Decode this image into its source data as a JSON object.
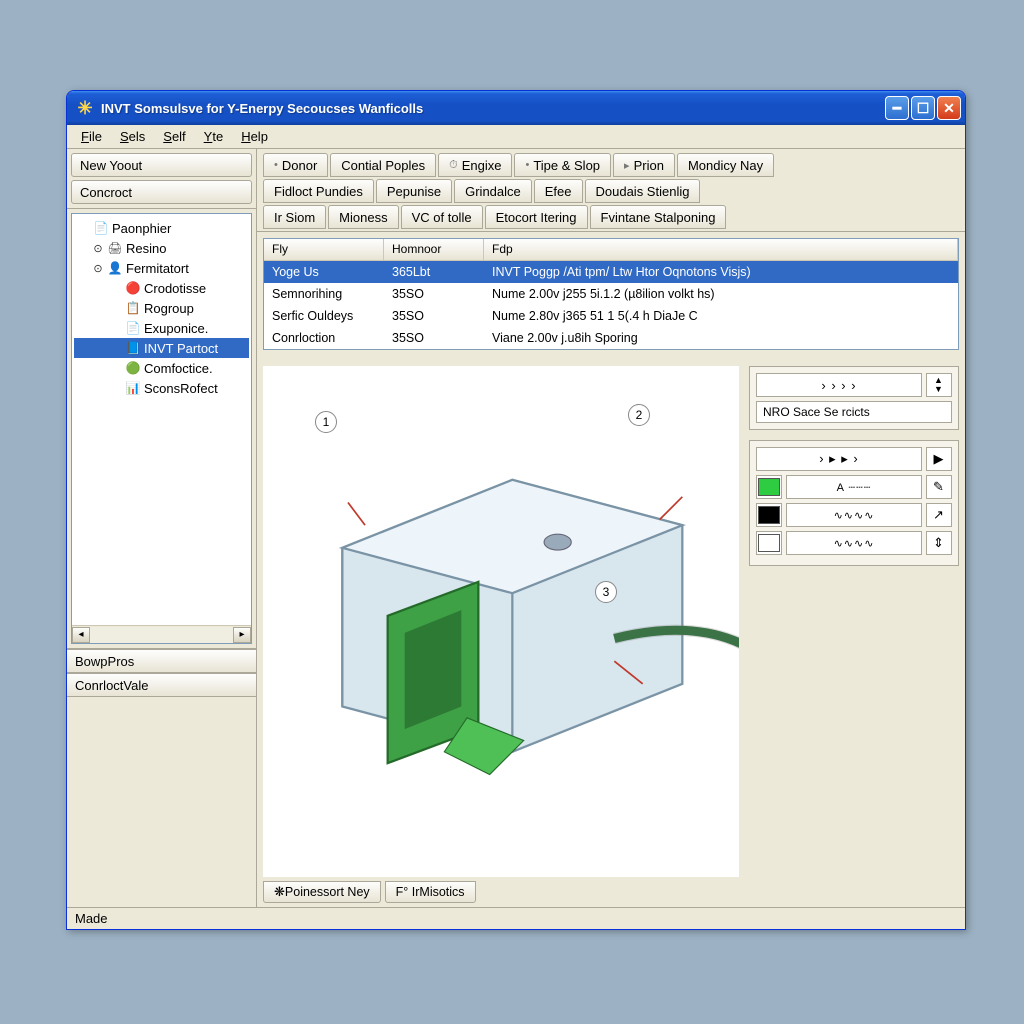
{
  "title": "INVT Somsulsve for Y-Enerpy Secoucses Wanficolls",
  "menus": [
    "File",
    "Sels",
    "Self",
    "Yte",
    "Help"
  ],
  "left_buttons": [
    "New Yoout",
    "Concroct"
  ],
  "tree": [
    {
      "label": "Paonphier",
      "depth": 0,
      "icon": "📄",
      "expander": "",
      "color": "#3a6ec0"
    },
    {
      "label": "Resino",
      "depth": 1,
      "icon": "🖨",
      "expander": "⊙",
      "color": "#555"
    },
    {
      "label": "Fermitatort",
      "depth": 1,
      "icon": "👤",
      "expander": "⊙",
      "color": "#2a8a2a"
    },
    {
      "label": "Crodotisse",
      "depth": 2,
      "icon": "🔴",
      "expander": "",
      "color": "#d02a2a"
    },
    {
      "label": "Rogroup",
      "depth": 2,
      "icon": "📋",
      "expander": "",
      "color": "#b05a1a"
    },
    {
      "label": "Exuponice.",
      "depth": 2,
      "icon": "📄",
      "expander": "",
      "color": "#c78a2a"
    },
    {
      "label": "INVT Partoct",
      "depth": 2,
      "icon": "📘",
      "expander": "",
      "selected": true,
      "color": "#fff"
    },
    {
      "label": "Comfoctice.",
      "depth": 2,
      "icon": "🟢",
      "expander": "",
      "color": "#2a8a2a"
    },
    {
      "label": "SconsRofect",
      "depth": 2,
      "icon": "📊",
      "expander": "",
      "color": "#3a6ec0"
    }
  ],
  "lower_panel_1": "BowpPros",
  "lower_panel_2": "ConrloctVale",
  "tab_rows": [
    [
      {
        "l": "Donor",
        "i": "•"
      },
      {
        "l": "Contial Poples"
      },
      {
        "l": "Engixe",
        "i": "⏱"
      },
      {
        "l": "Tipe & Slop",
        "i": "•"
      },
      {
        "l": "Prion",
        "i": "▸"
      },
      {
        "l": "Mondicy Nay"
      }
    ],
    [
      {
        "l": "Fidloct Pundies"
      },
      {
        "l": "Pepunise"
      },
      {
        "l": "Grindalce"
      },
      {
        "l": "Efee"
      },
      {
        "l": "Doudais Stienlig"
      }
    ],
    [
      {
        "l": "Ir Siom"
      },
      {
        "l": "Mioness"
      },
      {
        "l": "VC of tolle"
      },
      {
        "l": "Etocort Itering"
      },
      {
        "l": "Fvintane Stalponing"
      }
    ]
  ],
  "table": {
    "headers": [
      "Fly",
      "Homnoor",
      "Fdp"
    ],
    "rows": [
      {
        "c1": "Yoge Us",
        "c2": "365Lbt",
        "c3": "INVT Poggp /Ati tpm/ Ltw Htor Oqnotons Visjs)",
        "sel": true
      },
      {
        "c1": "Semnorihing",
        "c2": "35SO",
        "c3": "Nume 2.00v j255 5i.1.2 (µ8ilion volkt hs)"
      },
      {
        "c1": "Serfic Ouldeys",
        "c2": "35SO",
        "c3": "Nume 2.80v j365 51 1 5(.4 h DiaJe C"
      },
      {
        "c1": "Conrloction",
        "c2": "35SO",
        "c3": "Viane 2.00v j.u8ih Sporing"
      }
    ]
  },
  "callouts": [
    "1",
    "2",
    "3"
  ],
  "toolbox_label": "NRO Sace Se rcicts",
  "bottom_tabs": [
    {
      "l": "Poinessort Ney",
      "i": "❋"
    },
    {
      "l": "F° IrMisotics"
    }
  ],
  "status": "Made"
}
